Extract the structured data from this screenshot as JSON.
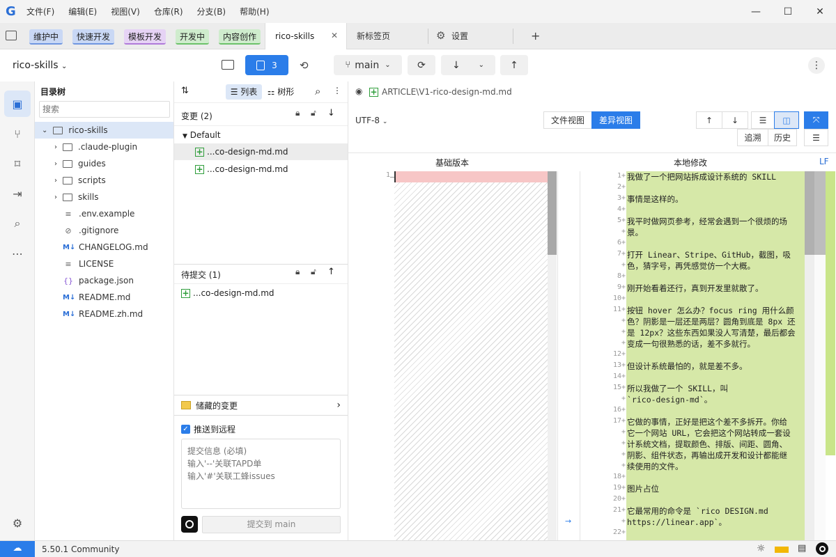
{
  "menu": {
    "items": [
      "文件(F)",
      "编辑(E)",
      "视图(V)",
      "仓库(R)",
      "分支(B)",
      "帮助(H)"
    ]
  },
  "tabs": {
    "tags": [
      {
        "label": "维护中",
        "bg": "#c9d8f5",
        "border": "#6f96e0"
      },
      {
        "label": "快速开发",
        "bg": "#c9d8f5",
        "border": "#6f96e0"
      },
      {
        "label": "模板开发",
        "bg": "#e6d3f5",
        "border": "#b07ad9"
      },
      {
        "label": "开发中",
        "bg": "#cfeccd",
        "border": "#6cc26a"
      },
      {
        "label": "内容创作",
        "bg": "#cfeccd",
        "border": "#6cc26a"
      }
    ],
    "active": "rico-skills",
    "newtab": "新标签页",
    "settings": "设置",
    "add": "+"
  },
  "toolbar": {
    "repo": "rico-skills",
    "changes_count": "3",
    "branch": "main"
  },
  "tree": {
    "title": "目录树",
    "search_placeholder": "搜索",
    "root": "rico-skills",
    "folders": [
      ".claude-plugin",
      "guides",
      "scripts",
      "skills"
    ],
    "files": [
      {
        "name": ".env.example",
        "icon": "lines-icon"
      },
      {
        "name": ".gitignore",
        "icon": "ignore-icon"
      },
      {
        "name": "CHANGELOG.md",
        "icon": "markdown-icon"
      },
      {
        "name": "LICENSE",
        "icon": "lines-icon"
      },
      {
        "name": "package.json",
        "icon": "braces-icon"
      },
      {
        "name": "README.md",
        "icon": "markdown-icon"
      },
      {
        "name": "README.zh.md",
        "icon": "markdown-icon"
      }
    ]
  },
  "changes": {
    "list_label": "列表",
    "tree_label": "树形",
    "section_title": "变更 (2)",
    "group": "Default",
    "files": [
      "...co-design-md.md",
      "...co-design-md.md"
    ],
    "staged_title": "待提交 (1)",
    "staged_files": [
      "...co-design-md.md"
    ],
    "stash": "储藏的变更",
    "push_label": "推送到远程",
    "commit_placeholder": "提交信息 (必填)\n输入'--'关联TAPD单\n输入'#'关联工蜂issues",
    "commit_button": "提交到 main"
  },
  "diff": {
    "path": "ARTICLE\\V1-rico-design-md.md",
    "encoding": "UTF-8",
    "file_view": "文件视图",
    "diff_view": "差异视图",
    "trace": "追溯",
    "history": "历史",
    "base_label": "基础版本",
    "local_label": "本地修改",
    "eol": "LF",
    "left_line": "1",
    "lines": [
      {
        "n": "1",
        "t": "我做了一个把网站拆成设计系统的 SKILL"
      },
      {
        "n": "2",
        "t": ""
      },
      {
        "n": "3",
        "t": "事情是这样的。"
      },
      {
        "n": "4",
        "t": ""
      },
      {
        "n": "5",
        "t": "我平时做网页参考，经常会遇到一个很烦的场"
      },
      {
        "n": "",
        "t": "景。"
      },
      {
        "n": "6",
        "t": ""
      },
      {
        "n": "7",
        "t": "打开 Linear、Stripe、GitHub，截图，吸"
      },
      {
        "n": "",
        "t": "色，猜字号，再凭感觉仿一个大概。"
      },
      {
        "n": "8",
        "t": ""
      },
      {
        "n": "9",
        "t": "刚开始看着还行，真到开发里就散了。"
      },
      {
        "n": "10",
        "t": ""
      },
      {
        "n": "11",
        "t": "按钮 hover 怎么办？focus ring 用什么颜"
      },
      {
        "n": "",
        "t": "色？阴影是一层还是两层？圆角到底是 8px 还"
      },
      {
        "n": "",
        "t": "是 12px？这些东西如果没人写清楚，最后都会"
      },
      {
        "n": "",
        "t": "变成一句很熟悉的话，差不多就行。"
      },
      {
        "n": "12",
        "t": ""
      },
      {
        "n": "13",
        "t": "但设计系统最怕的，就是差不多。"
      },
      {
        "n": "14",
        "t": ""
      },
      {
        "n": "15",
        "t": "所以我做了一个 SKILL，叫"
      },
      {
        "n": "",
        "t": "`rico-design-md`。"
      },
      {
        "n": "16",
        "t": ""
      },
      {
        "n": "17",
        "t": "它做的事情，正好是把这个差不多拆开。你给"
      },
      {
        "n": "",
        "t": "它一个网站 URL，它会把这个网站转成一套设"
      },
      {
        "n": "",
        "t": "计系统文档，提取颜色、排版、间距、圆角、"
      },
      {
        "n": "",
        "t": "阴影、组件状态，再输出成开发和设计都能继"
      },
      {
        "n": "",
        "t": "续使用的文件。"
      },
      {
        "n": "18",
        "t": ""
      },
      {
        "n": "19",
        "t": "图片占位"
      },
      {
        "n": "20",
        "t": ""
      },
      {
        "n": "21",
        "t": "它最常用的命令是 `rico DESIGN.md"
      },
      {
        "n": "",
        "t": "https://linear.app`。"
      },
      {
        "n": "22",
        "t": ""
      }
    ]
  },
  "status": {
    "version": "5.50.1 Community"
  }
}
